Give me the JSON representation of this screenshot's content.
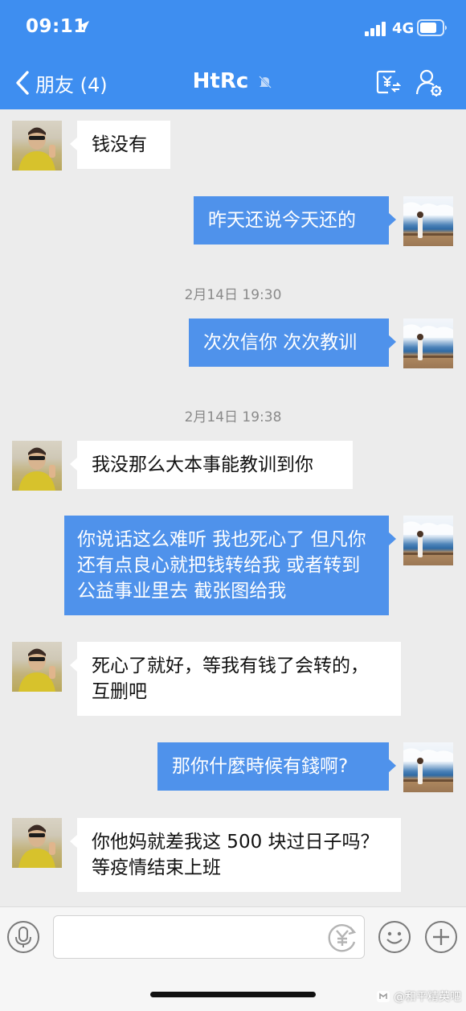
{
  "status_bar": {
    "time": "09:11",
    "network": "4G"
  },
  "nav": {
    "back_label": "朋友 (4)",
    "title": "HtRc"
  },
  "messages": [
    {
      "side": "in",
      "text": "钱没有"
    },
    {
      "side": "out",
      "text": "昨天还说今天还的"
    },
    {
      "timestamp": "2月14日 19:30"
    },
    {
      "side": "out",
      "text": "次次信你 次次教训"
    },
    {
      "timestamp": "2月14日 19:38"
    },
    {
      "side": "in",
      "text": "我没那么大本事能教训到你"
    },
    {
      "side": "out",
      "text": "你说话这么难听 我也死心了 但凡你还有点良心就把钱转给我 或者转到公益事业里去 截张图给我"
    },
    {
      "side": "in",
      "text": "死心了就好，等我有钱了会转的，互删吧"
    },
    {
      "side": "out",
      "text": "那你什麼時候有錢啊?"
    },
    {
      "side": "in",
      "text": "你他妈就差我这 500 块过日子吗？等疫情结束上班"
    }
  ],
  "composer": {
    "value": "",
    "placeholder": ""
  },
  "watermark": "@和平精英吧",
  "colors": {
    "header": "#3e8ef0",
    "out_bubble": "#4f92eb",
    "in_bubble": "#ffffff",
    "background": "#ececec"
  },
  "icons": {
    "back": "chevron-left-icon",
    "mute": "bell-muted-icon",
    "money": "yuan-transfer-icon",
    "profile": "person-settings-icon",
    "voice": "microphone-icon",
    "red_packet": "yuan-circle-icon",
    "emoji": "smiley-icon",
    "plus": "plus-circle-icon"
  }
}
